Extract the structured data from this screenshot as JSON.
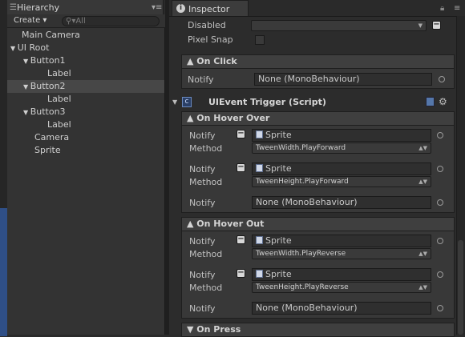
{
  "hierarchy": {
    "tab_label": "Hierarchy",
    "create_label": "Create ▾",
    "search_placeholder": "All",
    "items": [
      {
        "label": "Main Camera"
      },
      {
        "label": "UI Root"
      },
      {
        "label": "Button1"
      },
      {
        "label": "Label"
      },
      {
        "label": "Button2"
      },
      {
        "label": "Label"
      },
      {
        "label": "Button3"
      },
      {
        "label": "Label"
      },
      {
        "label": "Camera"
      },
      {
        "label": "Sprite"
      }
    ]
  },
  "inspector": {
    "tab_label": "Inspector",
    "disabled_label": "Disabled",
    "pixel_snap_label": "Pixel Snap",
    "on_click": {
      "header": "▲ On Click",
      "notify_label": "Notify",
      "notify_value": "None (MonoBehaviour)"
    },
    "component_title": "UIEvent Trigger (Script)",
    "on_hover_over": {
      "header": "▲ On Hover Over",
      "entries": [
        {
          "notify_label": "Notify",
          "notify_value": "Sprite",
          "method_label": "Method",
          "method_value": "TweenWidth.PlayForward"
        },
        {
          "notify_label": "Notify",
          "notify_value": "Sprite",
          "method_label": "Method",
          "method_value": "TweenHeight.PlayForward"
        }
      ],
      "empty_notify_label": "Notify",
      "empty_notify_value": "None (MonoBehaviour)"
    },
    "on_hover_out": {
      "header": "▲ On Hover Out",
      "entries": [
        {
          "notify_label": "Notify",
          "notify_value": "Sprite",
          "method_label": "Method",
          "method_value": "TweenWidth.PlayReverse"
        },
        {
          "notify_label": "Notify",
          "notify_value": "Sprite",
          "method_label": "Method",
          "method_value": "TweenHeight.PlayReverse"
        }
      ],
      "empty_notify_label": "Notify",
      "empty_notify_value": "None (MonoBehaviour)"
    },
    "on_press_header": "▼ On Press"
  }
}
